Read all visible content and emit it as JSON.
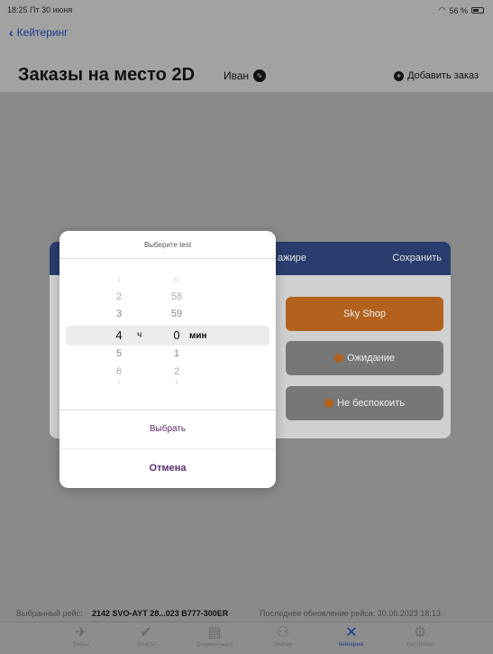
{
  "status": {
    "time": "18:25  Пт 30 июня",
    "battery": "56 %",
    "wifi_icon": "wifi-icon"
  },
  "nav": {
    "back_label": "Кейтеринг",
    "title": "Заказы на место 2D",
    "user": "Иван",
    "add_label": "Добавить заказ"
  },
  "card": {
    "header_left": "ажире",
    "header_right": "Сохранить",
    "buttons": [
      "Sky Shop",
      "Ожидание",
      "Не беспокоить"
    ]
  },
  "picker": {
    "title": "Выберите test",
    "hours": [
      "1",
      "2",
      "3",
      "4",
      "5",
      "6",
      "7"
    ],
    "minutes": [
      "57",
      "58",
      "59",
      "0",
      "1",
      "2",
      "3"
    ],
    "hour_unit": "ч",
    "minute_unit": "мин",
    "choose_label": "Выбрать",
    "cancel_label": "Отмена"
  },
  "info": {
    "flight_label": "Выбранный рейс:",
    "flight_value": "2142 SVO-AYT 28...023 B777-300ER",
    "update_label": "Последнее обновление рейса: 30.06.2023 18:13"
  },
  "tabs": [
    {
      "label": "Рейсы",
      "icon": "plane-icon"
    },
    {
      "label": "Отчеты",
      "icon": "check-circle-icon"
    },
    {
      "label": "Документация",
      "icon": "document-icon"
    },
    {
      "label": "Экипаж",
      "icon": "crew-icon"
    },
    {
      "label": "Кейтеринг",
      "icon": "utensils-icon"
    },
    {
      "label": "Настройки",
      "icon": "settings-icon"
    }
  ],
  "colors": {
    "accent": "#1b3a8f",
    "orange": "#b3621e",
    "purple": "#5b2c6f"
  }
}
